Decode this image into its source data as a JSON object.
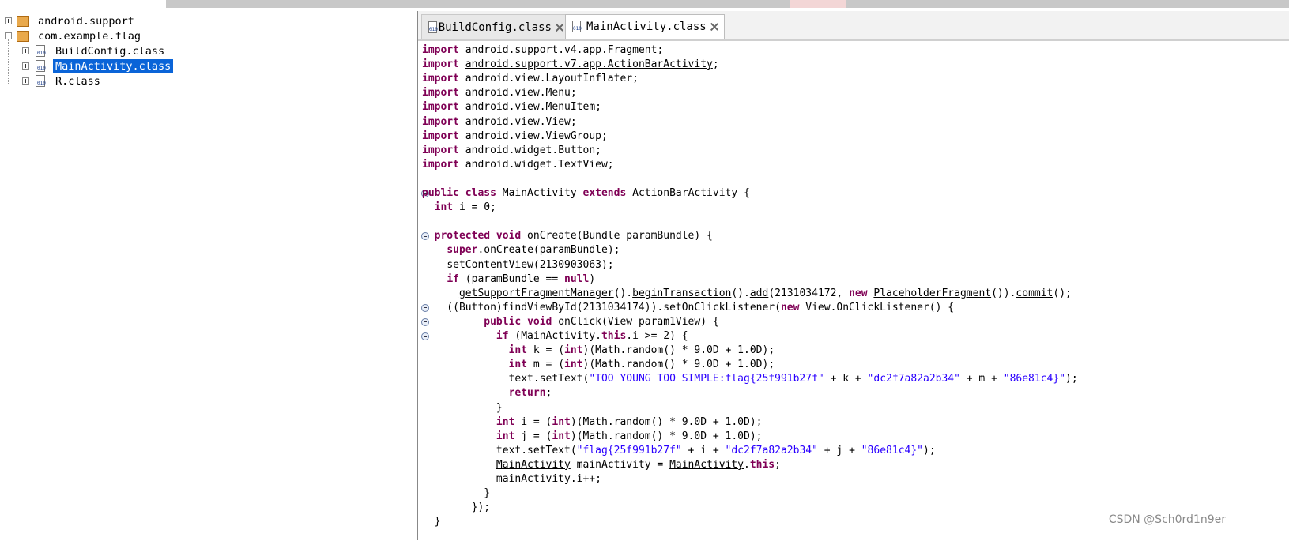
{
  "tree": {
    "items": [
      {
        "label": "android.support",
        "type": "package",
        "expanded": false
      },
      {
        "label": "com.example.flag",
        "type": "package",
        "expanded": true
      },
      {
        "label": "BuildConfig.class",
        "type": "class",
        "expanded": false
      },
      {
        "label": "MainActivity.class",
        "type": "class",
        "expanded": false,
        "selected": true
      },
      {
        "label": "R.class",
        "type": "class",
        "expanded": false
      }
    ]
  },
  "tabs": [
    {
      "label": "BuildConfig.class",
      "active": false
    },
    {
      "label": "MainActivity.class",
      "active": true
    }
  ],
  "icons": {
    "package": "package-icon",
    "class": "class-file-icon",
    "close": "close-icon",
    "fold": "fold-collapse-icon",
    "class_bits": "010"
  },
  "code": {
    "lines": [
      [
        [
          "kw",
          "import"
        ],
        [
          "txt",
          " "
        ],
        [
          "u",
          "android.support.v4.app.Fragment"
        ],
        [
          "txt",
          ";"
        ]
      ],
      [
        [
          "kw",
          "import"
        ],
        [
          "txt",
          " "
        ],
        [
          "u",
          "android.support.v7.app.ActionBarActivity"
        ],
        [
          "txt",
          ";"
        ]
      ],
      [
        [
          "kw",
          "import"
        ],
        [
          "txt",
          " android.view.LayoutInflater;"
        ]
      ],
      [
        [
          "kw",
          "import"
        ],
        [
          "txt",
          " android.view.Menu;"
        ]
      ],
      [
        [
          "kw",
          "import"
        ],
        [
          "txt",
          " android.view.MenuItem;"
        ]
      ],
      [
        [
          "kw",
          "import"
        ],
        [
          "txt",
          " android.view.View;"
        ]
      ],
      [
        [
          "kw",
          "import"
        ],
        [
          "txt",
          " android.view.ViewGroup;"
        ]
      ],
      [
        [
          "kw",
          "import"
        ],
        [
          "txt",
          " android.widget.Button;"
        ]
      ],
      [
        [
          "kw",
          "import"
        ],
        [
          "txt",
          " android.widget.TextView;"
        ]
      ],
      [],
      [
        [
          "kw",
          "public class"
        ],
        [
          "txt",
          " MainActivity "
        ],
        [
          "kw",
          "extends"
        ],
        [
          "txt",
          " "
        ],
        [
          "u",
          "ActionBarActivity"
        ],
        [
          "txt",
          " {"
        ]
      ],
      [
        [
          "txt",
          "  "
        ],
        [
          "kw",
          "int"
        ],
        [
          "txt",
          " i = 0;"
        ]
      ],
      [],
      [
        [
          "txt",
          "  "
        ],
        [
          "kw",
          "protected void"
        ],
        [
          "txt",
          " onCreate(Bundle paramBundle) {"
        ]
      ],
      [
        [
          "txt",
          "    "
        ],
        [
          "kw",
          "super"
        ],
        [
          "txt",
          "."
        ],
        [
          "u",
          "onCreate"
        ],
        [
          "txt",
          "(paramBundle);"
        ]
      ],
      [
        [
          "txt",
          "    "
        ],
        [
          "u",
          "setContentView"
        ],
        [
          "txt",
          "(2130903063);"
        ]
      ],
      [
        [
          "txt",
          "    "
        ],
        [
          "kw",
          "if"
        ],
        [
          "txt",
          " (paramBundle == "
        ],
        [
          "kw",
          "null"
        ],
        [
          "txt",
          ")"
        ]
      ],
      [
        [
          "txt",
          "      "
        ],
        [
          "u",
          "getSupportFragmentManager"
        ],
        [
          "txt",
          "()."
        ],
        [
          "u",
          "beginTransaction"
        ],
        [
          "txt",
          "()."
        ],
        [
          "u",
          "add"
        ],
        [
          "txt",
          "(2131034172, "
        ],
        [
          "kw",
          "new"
        ],
        [
          "txt",
          " "
        ],
        [
          "u",
          "PlaceholderFragment"
        ],
        [
          "txt",
          "())."
        ],
        [
          "u",
          "commit"
        ],
        [
          "txt",
          "();"
        ]
      ],
      [
        [
          "txt",
          "    ((Button)findViewById(2131034174)).setOnClickListener("
        ],
        [
          "kw",
          "new"
        ],
        [
          "txt",
          " View.OnClickListener() {"
        ]
      ],
      [
        [
          "txt",
          "          "
        ],
        [
          "kw",
          "public void"
        ],
        [
          "txt",
          " onClick(View param1View) {"
        ]
      ],
      [
        [
          "txt",
          "            "
        ],
        [
          "kw",
          "if"
        ],
        [
          "txt",
          " ("
        ],
        [
          "u",
          "MainActivity"
        ],
        [
          "txt",
          "."
        ],
        [
          "kw",
          "this"
        ],
        [
          "txt",
          "."
        ],
        [
          "u",
          "i"
        ],
        [
          "txt",
          " >= 2) {"
        ]
      ],
      [
        [
          "txt",
          "              "
        ],
        [
          "kw",
          "int"
        ],
        [
          "txt",
          " k = ("
        ],
        [
          "kw",
          "int"
        ],
        [
          "txt",
          ")(Math.random() * 9.0D + 1.0D);"
        ]
      ],
      [
        [
          "txt",
          "              "
        ],
        [
          "kw",
          "int"
        ],
        [
          "txt",
          " m = ("
        ],
        [
          "kw",
          "int"
        ],
        [
          "txt",
          ")(Math.random() * 9.0D + 1.0D);"
        ]
      ],
      [
        [
          "txt",
          "              text.setText("
        ],
        [
          "str",
          "\"TOO YOUNG TOO SIMPLE:flag{25f991b27f\""
        ],
        [
          "txt",
          " + k + "
        ],
        [
          "str",
          "\"dc2f7a82a2b34\""
        ],
        [
          "txt",
          " + m + "
        ],
        [
          "str",
          "\"86e81c4}\""
        ],
        [
          "txt",
          ");"
        ]
      ],
      [
        [
          "txt",
          "              "
        ],
        [
          "kw",
          "return"
        ],
        [
          "txt",
          ";"
        ]
      ],
      [
        [
          "txt",
          "            }"
        ]
      ],
      [
        [
          "txt",
          "            "
        ],
        [
          "kw",
          "int"
        ],
        [
          "txt",
          " i = ("
        ],
        [
          "kw",
          "int"
        ],
        [
          "txt",
          ")(Math.random() * 9.0D + 1.0D);"
        ]
      ],
      [
        [
          "txt",
          "            "
        ],
        [
          "kw",
          "int"
        ],
        [
          "txt",
          " j = ("
        ],
        [
          "kw",
          "int"
        ],
        [
          "txt",
          ")(Math.random() * 9.0D + 1.0D);"
        ]
      ],
      [
        [
          "txt",
          "            text.setText("
        ],
        [
          "str",
          "\"flag{25f991b27f\""
        ],
        [
          "txt",
          " + i + "
        ],
        [
          "str",
          "\"dc2f7a82a2b34\""
        ],
        [
          "txt",
          " + j + "
        ],
        [
          "str",
          "\"86e81c4}\""
        ],
        [
          "txt",
          ");"
        ]
      ],
      [
        [
          "txt",
          "            "
        ],
        [
          "u",
          "MainActivity"
        ],
        [
          "txt",
          " mainActivity = "
        ],
        [
          "u",
          "MainActivity"
        ],
        [
          "txt",
          "."
        ],
        [
          "kw",
          "this"
        ],
        [
          "txt",
          ";"
        ]
      ],
      [
        [
          "txt",
          "            mainActivity."
        ],
        [
          "u",
          "i"
        ],
        [
          "txt",
          "++;"
        ]
      ],
      [
        [
          "txt",
          "          }"
        ]
      ],
      [
        [
          "txt",
          "        });"
        ]
      ],
      [
        [
          "txt",
          "  }"
        ]
      ]
    ],
    "fold_lines": [
      10,
      13,
      18,
      19,
      20
    ]
  },
  "watermark": "CSDN @Sch0rd1n9er"
}
